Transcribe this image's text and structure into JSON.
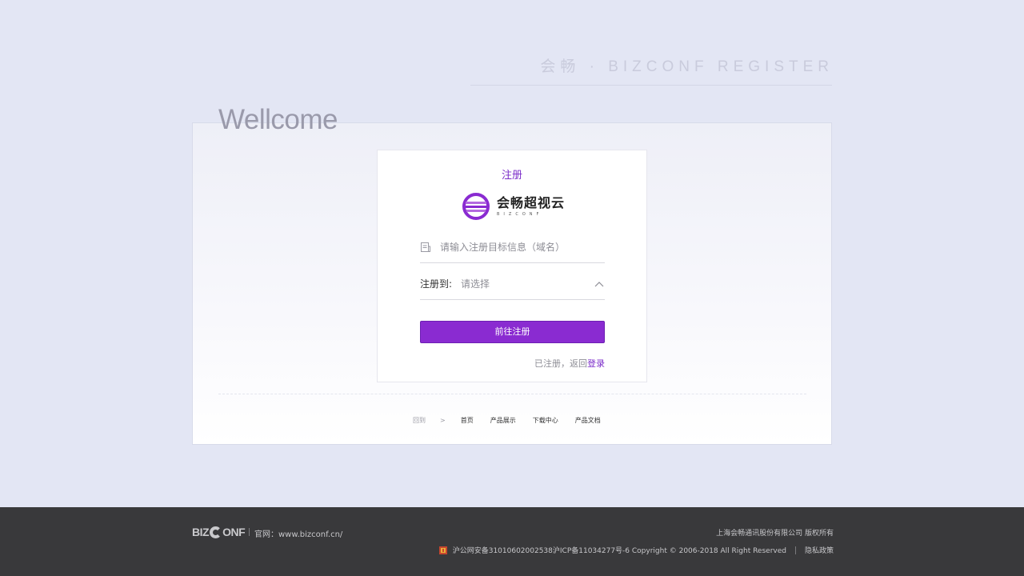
{
  "header": {
    "title": "会畅 · BIZCONF REGISTER",
    "welcome": "Wellcome"
  },
  "form": {
    "title": "注册",
    "logo": {
      "name_cn": "会畅超视云",
      "name_en": "BIZCONF",
      "icon": "bizconf-logo-icon"
    },
    "domain_input": {
      "placeholder": "请输入注册目标信息（域名）",
      "value": "",
      "icon": "document-icon"
    },
    "register_to": {
      "label": "注册到:",
      "placeholder": "请选择",
      "icon": "chevron-up-icon"
    },
    "submit_label": "前往注册",
    "login_hint": "已注册，返回",
    "login_link": "登录"
  },
  "breadcrumb": {
    "prefix": "回到",
    "separator": ">",
    "links": [
      "首页",
      "产品展示",
      "下载中心",
      "产品文档"
    ]
  },
  "footer": {
    "logo_text_left": "BIZ",
    "logo_text_right": "ONF",
    "site": "官网：www.bizconf.cn/",
    "company": "上海会畅通讯股份有限公司 版权所有",
    "icp": "沪公网安备31010602002538沪ICP备11034277号-6 Copyright © 2006-2018 All Right Reserved",
    "privacy": "隐私政策"
  },
  "colors": {
    "accent": "#8a2bd1",
    "background": "#e3e6f4",
    "footer": "#39393b"
  }
}
